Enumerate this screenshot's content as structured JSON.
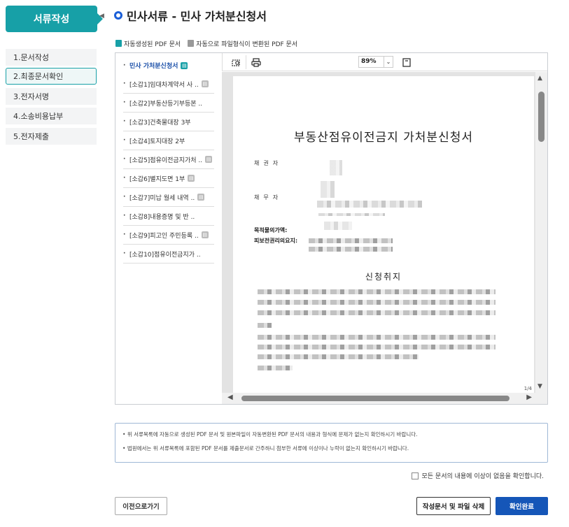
{
  "sidebar": {
    "header": "서류작성",
    "steps": [
      "1.문서작성",
      "2.최종문서확인",
      "3.전자서명",
      "4.소송비용납부",
      "5.전자제출"
    ],
    "active_step": 1
  },
  "page_title": "민사서류 - 민사 가처분신청서",
  "legend": {
    "auto_pdf": "자동생성된 PDF 문서",
    "converted_pdf": "자동으로 파일형식이 변환된 PDF 문서"
  },
  "documents": [
    "민사 가처분신청서",
    "[소갑1]임대차계약서 사 ..",
    "[소갑2]부동산등기부등본 ..",
    "[소갑3]건축물대장 3부",
    "[소갑4]토지대장 2부",
    "[소갑5]점유이전금지가처 ..",
    "[소갑6]별지도면 1부",
    "[소갑7]미납 월세 내역 ..",
    "[소갑8]내용증명 및 반 ..",
    "[소갑9]피고인 주민등록 ..",
    "[소갑10]점유이전금지가 .."
  ],
  "toolbar": {
    "zoom": "89%"
  },
  "pdf": {
    "title": "부동산점유이전금지 가처분신청서",
    "creditor_label": "채권자",
    "debtor_label": "채무자",
    "object_value_label": "목적물의가액:",
    "preserved_right_label": "피보전권리의요지:",
    "section_purpose": "신청취지",
    "page_indicator": "1/4"
  },
  "notice": {
    "line1": "위 서류목록에 자동으로 생성된 PDF 문서 및 원본파일이 자동변환된 PDF 문서의 내용과 형식에 문제가 없는지 확인하시기 바랍니다.",
    "line2": "법원에서는 위 서류목록에 포함된 PDF 문서를 제출문서로 간주하니 첨부한 서류에 이상이나 누락이 없는지 확인하시기 바랍니다."
  },
  "confirm_text": "모든 문서의 내용에 이상이 없음을 확인합니다.",
  "buttons": {
    "prev": "이전으로가기",
    "delete": "작성문서 및 파일 삭제",
    "ok": "확인완료"
  },
  "colors": {
    "accent": "#17a0a7",
    "primary": "#1556b8"
  }
}
